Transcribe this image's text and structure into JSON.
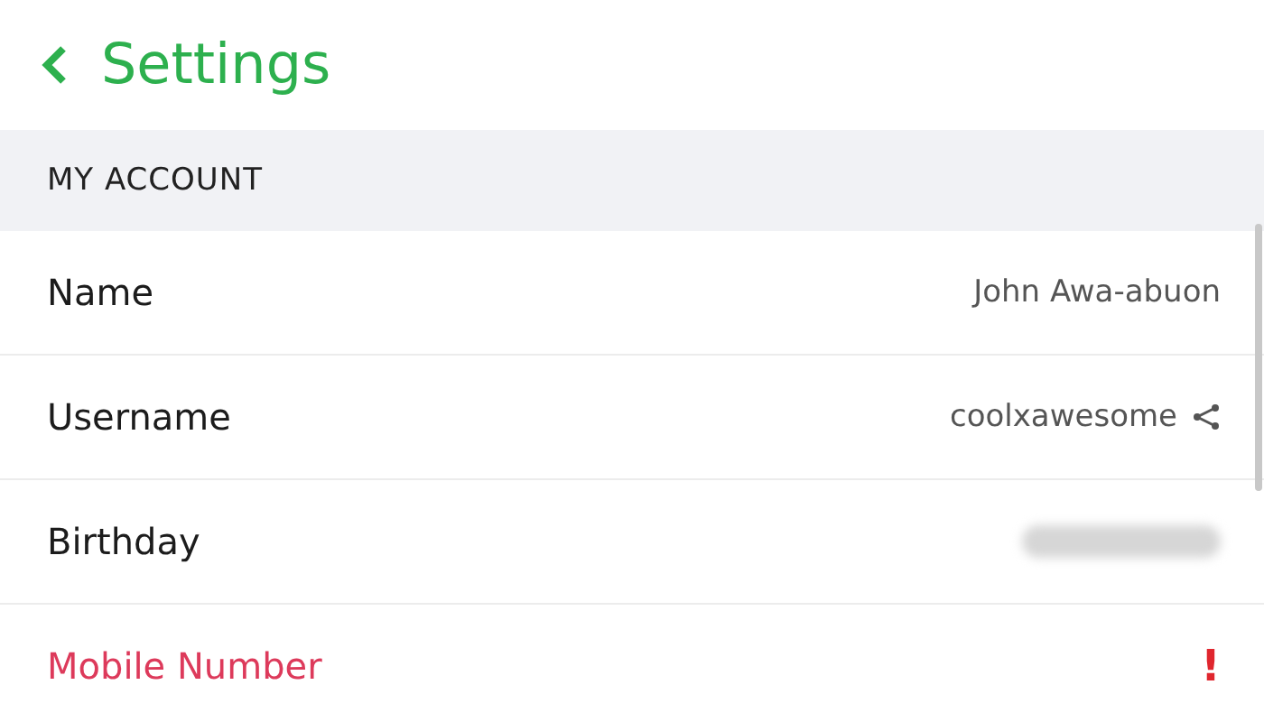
{
  "header": {
    "title": "Settings"
  },
  "section": {
    "title": "MY ACCOUNT"
  },
  "rows": [
    {
      "kind": "text",
      "label": "Name",
      "value": "John Awa-abuon"
    },
    {
      "kind": "share",
      "label": "Username",
      "value": "coolxawesome"
    },
    {
      "kind": "hidden",
      "label": "Birthday"
    },
    {
      "kind": "alert",
      "label": "Mobile Number",
      "alert": "!"
    }
  ]
}
